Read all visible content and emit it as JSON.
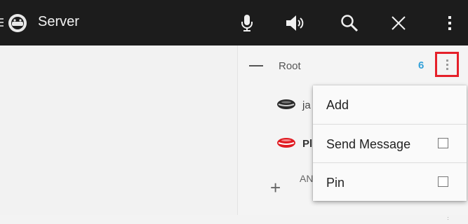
{
  "actionbar": {
    "title": "Server",
    "icons": [
      "app-icon",
      "microphone-icon",
      "speaker-icon",
      "search-icon",
      "close-icon",
      "overflow-menu-icon"
    ]
  },
  "channel_tree": {
    "root_label": "Root",
    "root_user_count": "6",
    "users": [
      {
        "name": "ja",
        "icon": "lips-muted-icon"
      },
      {
        "name": "Pl",
        "icon": "lips-talking-icon"
      }
    ],
    "subchannel_label": "AN"
  },
  "popup_menu": {
    "items": [
      {
        "label": "Add",
        "has_checkbox": false
      },
      {
        "label": "Send Message",
        "has_checkbox": true,
        "checked": false
      },
      {
        "label": "Pin",
        "has_checkbox": true,
        "checked": false
      }
    ]
  },
  "colors": {
    "actionbar_bg": "#1c1c1c",
    "count_accent": "#33a1d9",
    "highlight_border": "#e5202a"
  }
}
